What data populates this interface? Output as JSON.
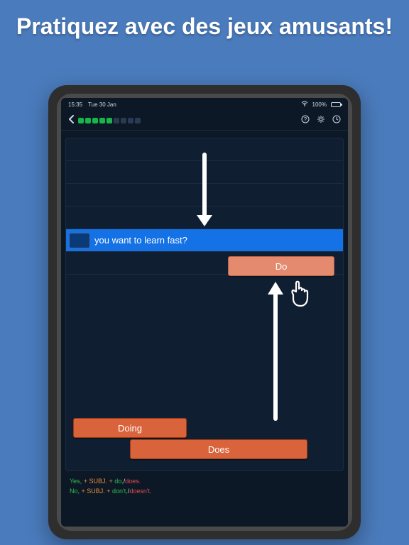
{
  "hero": {
    "title": "Pratiquez avec des jeux amusants!"
  },
  "status": {
    "time": "15:35",
    "date": "Tue 30 Jan",
    "battery": "100%"
  },
  "progress": {
    "done": 5,
    "total": 9
  },
  "game": {
    "prompt_text": "you want to learn fast?",
    "tiles": {
      "do": "Do",
      "doing": "Doing",
      "does": "Does"
    }
  },
  "hints": {
    "line1": {
      "a": "Yes,",
      "b": " + SUBJ. + ",
      "c": "do,",
      "d": "/",
      "e": "does."
    },
    "line2": {
      "a": "No,",
      "b": " + SUBJ. + ",
      "c": "don't,",
      "d": "/",
      "e": "doesn't."
    }
  }
}
